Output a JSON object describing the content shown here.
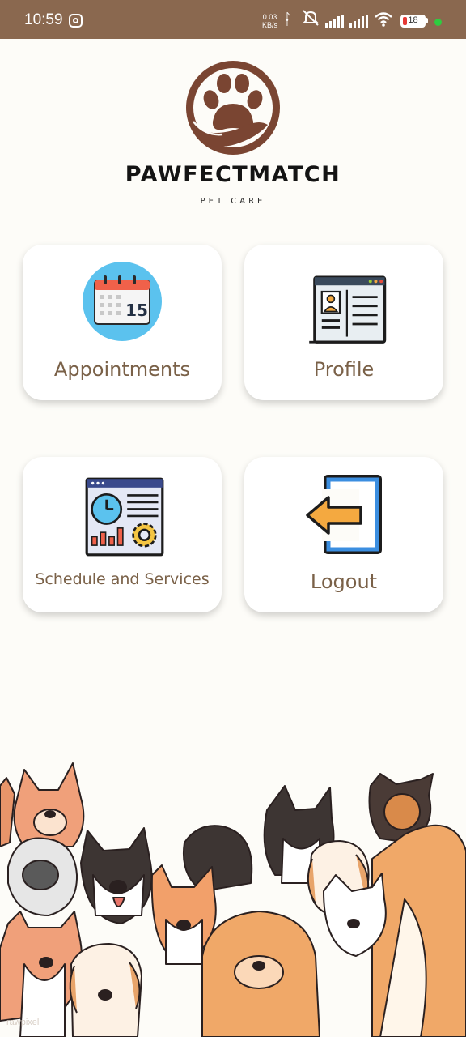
{
  "status_bar": {
    "time": "10:59",
    "net_speed_value": "0.03",
    "net_speed_unit": "KB/s",
    "battery_level": "18",
    "battery_fraction": 0.18,
    "colors": {
      "background": "#8a684f",
      "battery_low": "#e53935",
      "dot": "#2ecc40"
    },
    "icons": [
      "instagram-icon",
      "bluetooth-icon",
      "mute-icon",
      "signal-icon",
      "signal-icon",
      "wifi-icon",
      "battery-icon"
    ]
  },
  "brand": {
    "name": "PAWFECTMATCH",
    "tagline": "PET CARE",
    "logo_color": "#7a4532"
  },
  "menu": {
    "appointments": {
      "label": "Appointments",
      "icon": "calendar-icon",
      "calendar_day": "15"
    },
    "profile": {
      "label": "Profile",
      "icon": "profile-card-icon"
    },
    "schedule": {
      "label": "Schedule and Services",
      "icon": "dashboard-icon"
    },
    "logout": {
      "label": "Logout",
      "icon": "logout-icon"
    }
  },
  "footer": {
    "illustration": "dogs-illustration",
    "watermark": "rawpixel"
  },
  "colors": {
    "background": "#fdfcf8",
    "label": "#7a6148",
    "card": "#ffffff"
  }
}
